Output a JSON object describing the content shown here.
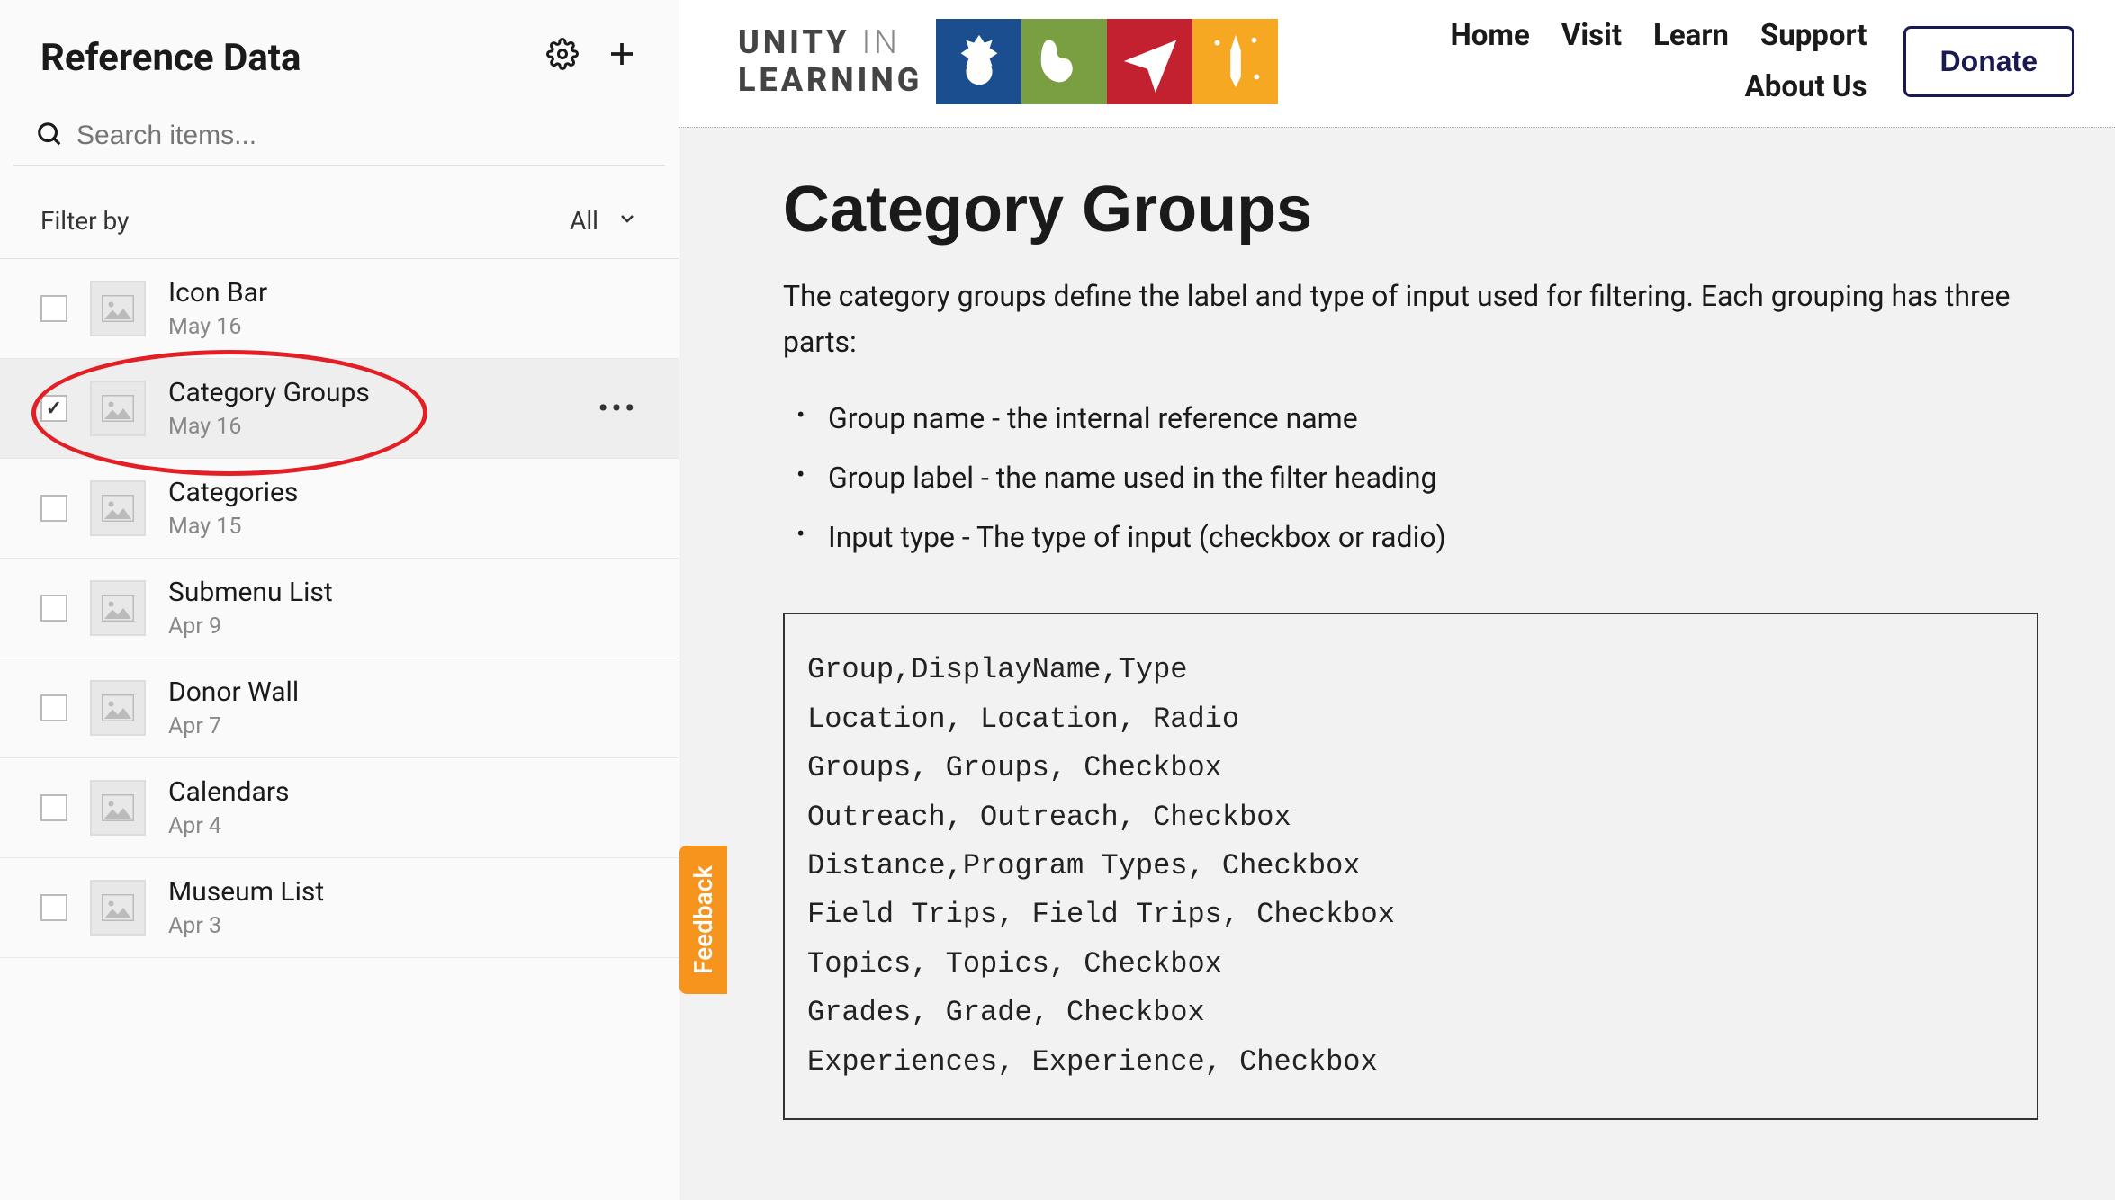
{
  "sidebar": {
    "title": "Reference Data",
    "search_placeholder": "Search items...",
    "filter_label": "Filter by",
    "filter_value": "All",
    "items": [
      {
        "title": "Icon Bar",
        "date": "May 16",
        "selected": false
      },
      {
        "title": "Category Groups",
        "date": "May 16",
        "selected": true
      },
      {
        "title": "Categories",
        "date": "May 15",
        "selected": false
      },
      {
        "title": "Submenu List",
        "date": "Apr 9",
        "selected": false
      },
      {
        "title": "Donor Wall",
        "date": "Apr 7",
        "selected": false
      },
      {
        "title": "Calendars",
        "date": "Apr 4",
        "selected": false
      },
      {
        "title": "Museum List",
        "date": "Apr 3",
        "selected": false
      }
    ]
  },
  "topnav": {
    "logo_line1a": "UNITY",
    "logo_line1b": "IN",
    "logo_line2": "LEARNING",
    "links": [
      "Home",
      "Visit",
      "Learn",
      "Support"
    ],
    "links2": [
      "About Us"
    ],
    "donate": "Donate"
  },
  "content": {
    "title": "Category Groups",
    "intro": "The category groups define the label and type of input used for filtering.  Each grouping has three parts:",
    "bullets": [
      "Group name - the internal reference name",
      "Group label - the name used in the filter heading",
      "Input type - The type of input (checkbox or radio)"
    ],
    "code": "Group,DisplayName,Type\nLocation, Location, Radio\nGroups, Groups, Checkbox\nOutreach, Outreach, Checkbox\nDistance,Program Types, Checkbox\nField Trips, Field Trips, Checkbox\nTopics, Topics, Checkbox\nGrades, Grade, Checkbox\nExperiences, Experience, Checkbox"
  },
  "feedback": "Feedback"
}
